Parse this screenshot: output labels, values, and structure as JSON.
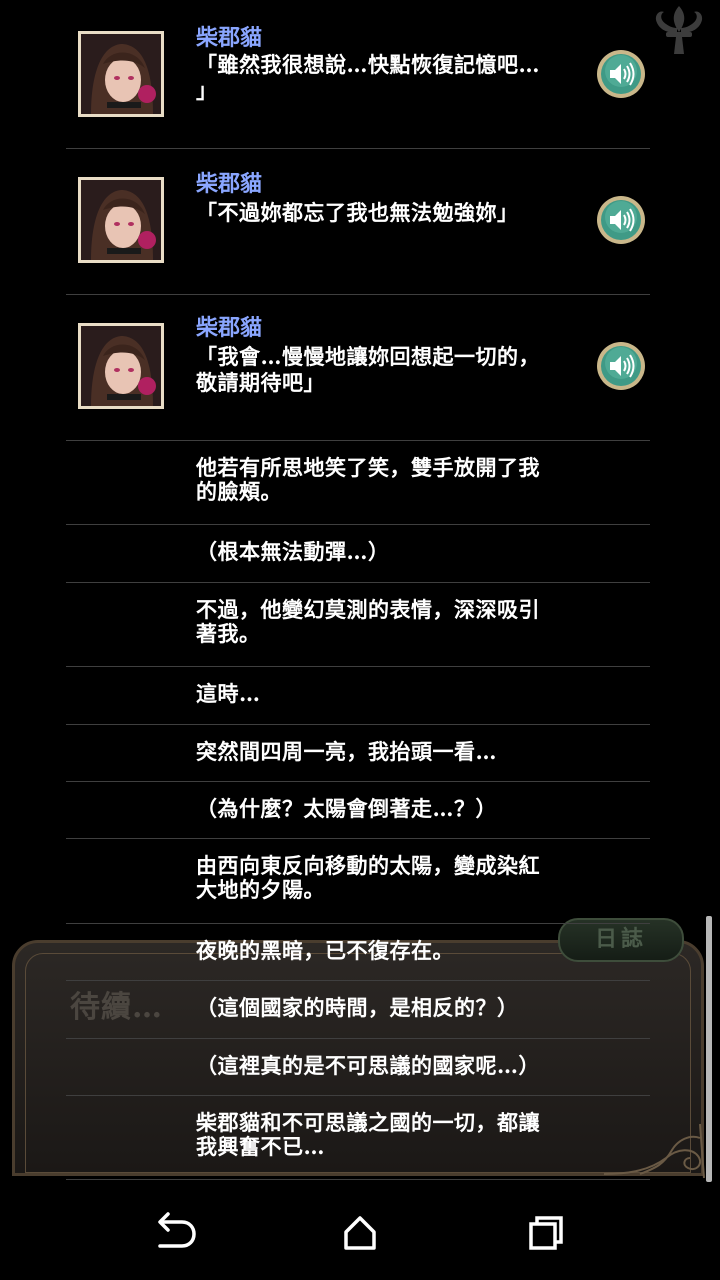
{
  "background": {
    "story_text": "待續…",
    "log_tab_label": "日誌"
  },
  "log": {
    "voiced_entries": [
      {
        "speaker": "柴郡貓",
        "text": "「雖然我很想說…快點恢復記憶吧…」",
        "line1": "「雖然我很想說…快點恢復記憶吧…",
        "line2": "」"
      },
      {
        "speaker": "柴郡貓",
        "text": "「不過妳都忘了我也無法勉強妳」",
        "line1": "「不過妳都忘了我也無法勉強妳」",
        "line2": ""
      },
      {
        "speaker": "柴郡貓",
        "text": "「我會…慢慢地讓妳回想起一切的，敬請期待吧」",
        "line1": "「我會…慢慢地讓妳回想起一切的，",
        "line2": "敬請期待吧」"
      }
    ],
    "narration": [
      {
        "line1": "他若有所思地笑了笑，雙手放開了我",
        "line2": "的臉頰。"
      },
      {
        "line1": "（根本無法動彈…）",
        "line2": ""
      },
      {
        "line1": "不過，他變幻莫測的表情，深深吸引",
        "line2": "著我。"
      },
      {
        "line1": "這時…",
        "line2": ""
      },
      {
        "line1": "突然間四周一亮，我抬頭一看…",
        "line2": ""
      },
      {
        "line1": "（為什麼？太陽會倒著走…？）",
        "line2": ""
      },
      {
        "line1": "由西向東反向移動的太陽，變成染紅",
        "line2": "大地的夕陽。"
      },
      {
        "line1": "夜晚的黑暗，已不復存在。",
        "line2": ""
      },
      {
        "line1": "（這個國家的時間，是相反的？）",
        "line2": ""
      },
      {
        "line1": "（這裡真的是不可思議的國家呢…）",
        "line2": ""
      },
      {
        "line1": "柴郡貓和不可思議之國的一切，都讓",
        "line2": "我興奮不已…"
      }
    ]
  },
  "icons": {
    "voice": "speaker-icon",
    "back": "back-arrow-icon",
    "home": "home-icon",
    "recents": "recents-icon",
    "fleur": "fleur-de-lis-icon"
  },
  "colors": {
    "speaker_name": "#8aa6ff",
    "voice_button": "#3f9a86",
    "divider": "#3f3f3f"
  }
}
